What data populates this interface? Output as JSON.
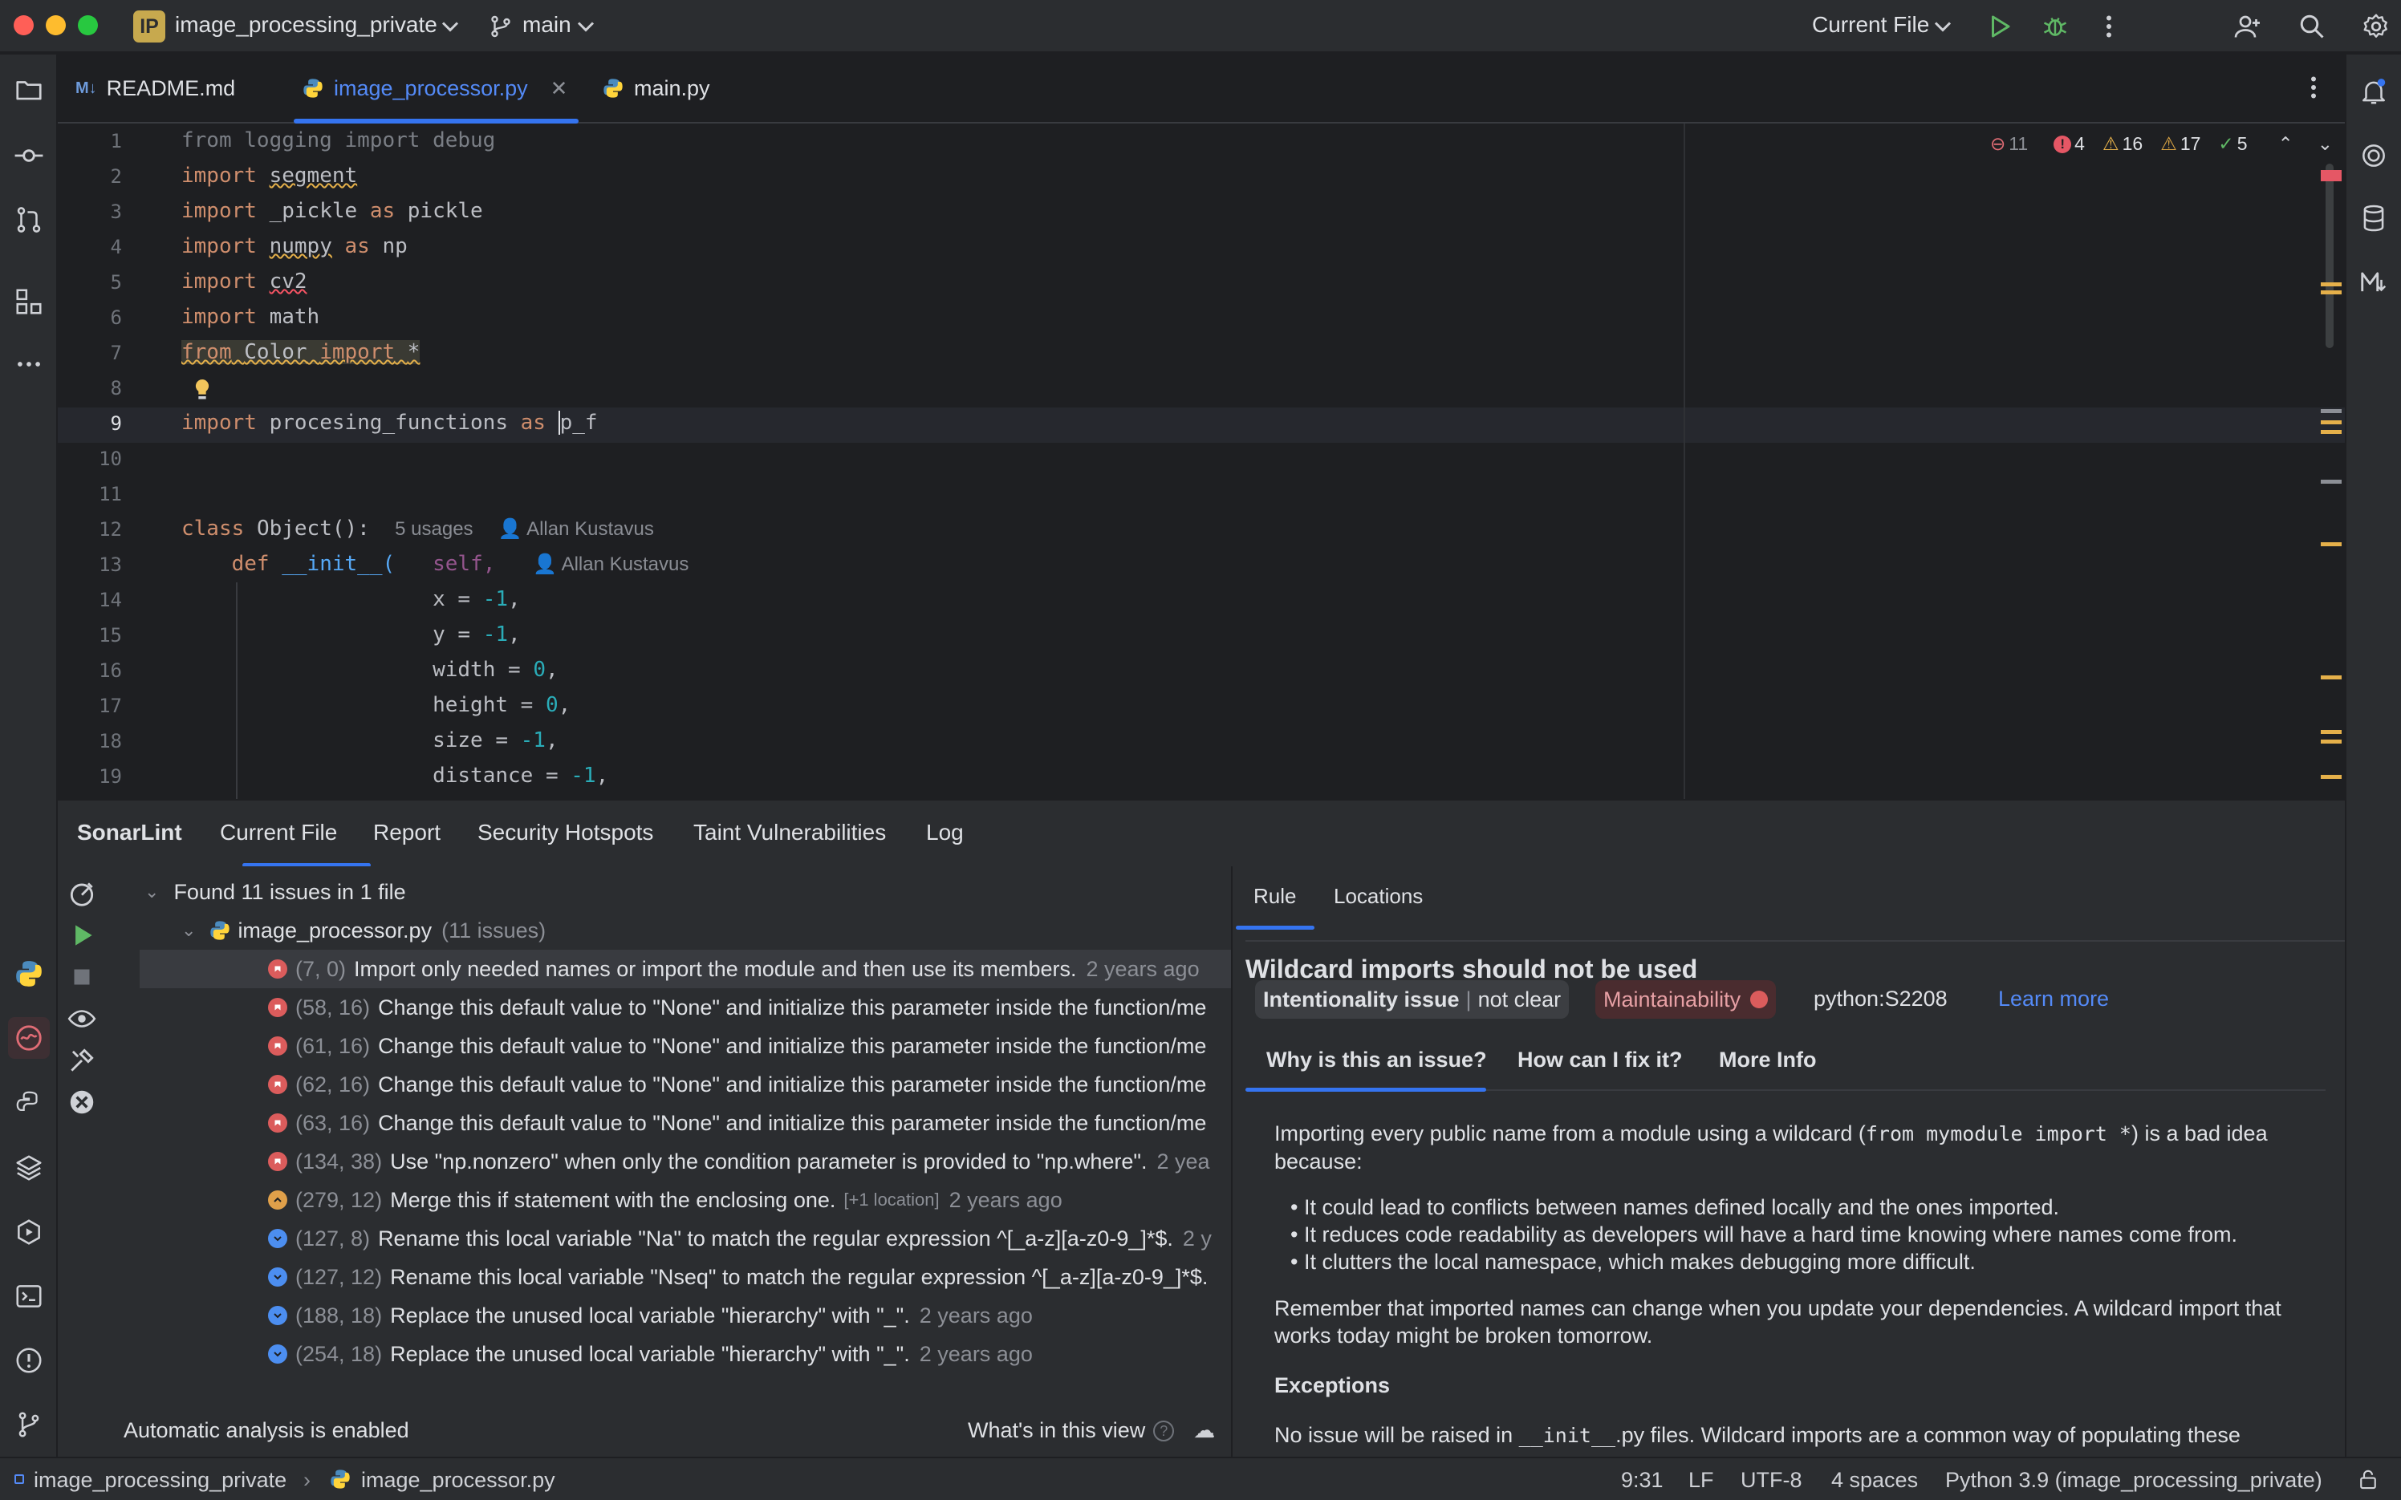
{
  "titlebar": {
    "project_badge": "IP",
    "project_name": "image_processing_private",
    "branch": "main",
    "run_config": "Current File",
    "colors": {
      "close": "#ff5f57",
      "minimize": "#febc2e",
      "maximize": "#28c840"
    }
  },
  "tabs": [
    {
      "label": "README.md",
      "icon": "markdown-icon"
    },
    {
      "label": "image_processor.py",
      "icon": "python-file-icon",
      "active": true
    },
    {
      "label": "main.py",
      "icon": "python-file-icon"
    }
  ],
  "tab_badges": {
    "markdown": "M↓"
  },
  "editor": {
    "inspection": {
      "sonar_errors": "11",
      "errors": "4",
      "warnings": "16",
      "weak_warnings": "17",
      "ok": "5"
    },
    "line_numbers": [
      "1",
      "2",
      "3",
      "4",
      "5",
      "6",
      "7",
      "8",
      "9",
      "10",
      "11",
      "12",
      "13",
      "14",
      "15",
      "16",
      "17",
      "18",
      "19"
    ],
    "code": {
      "l1": "from logging import debug",
      "l2_kw": "import",
      "l2_mod": "segment",
      "l3_kw": "import",
      "l3_mod": "_pickle",
      "l3_as": "as",
      "l3_alias": "pickle",
      "l4_kw": "import",
      "l4_mod": "numpy",
      "l4_as": "as",
      "l4_alias": "np",
      "l5_kw": "import",
      "l5_mod": "cv2",
      "l6_kw": "import",
      "l6_mod": "math",
      "l7_from": "from",
      "l7_mod": "Color",
      "l7_kw": "import",
      "l7_star": "*",
      "l9_kw": "import",
      "l9_mod": "procesing_functions",
      "l9_as": "as",
      "l9_alias": "p_f",
      "l12_kw": "class",
      "l12_name": "Object():",
      "l12_usages": "5 usages",
      "l12_author": "Allan Kustavus",
      "l13_kw": "def",
      "l13_fn": "__init__(",
      "l13_self": "self,",
      "l13_author": "Allan Kustavus",
      "l14_name": "x = ",
      "l14_val": "-1",
      "l14_end": ",",
      "l15_name": "y = ",
      "l15_val": "-1",
      "l15_end": ",",
      "l16_name": "width = ",
      "l16_val": "0",
      "l16_end": ",",
      "l17_name": "height = ",
      "l17_val": "0",
      "l17_end": ",",
      "l18_name": "size = ",
      "l18_val": "-1",
      "l18_end": ",",
      "l19_name": "distance = ",
      "l19_val": "-1",
      "l19_end": ","
    }
  },
  "sonarlint": {
    "title": "SonarLint",
    "tabs": [
      "Current File",
      "Report",
      "Security Hotspots",
      "Taint Vulnerabilities",
      "Log"
    ],
    "summary": "Found 11 issues in 1 file",
    "file": {
      "name": "image_processor.py",
      "count": "(11 issues)"
    },
    "issues": [
      {
        "loc": "(7, 0)",
        "msg": "Import only needed names or import the module and then use its members.",
        "ago": "2 years ago",
        "severity": "blocker"
      },
      {
        "loc": "(58, 16)",
        "msg": "Change this default value to \"None\" and initialize this parameter inside the function/me",
        "ago": "",
        "severity": "blocker"
      },
      {
        "loc": "(61, 16)",
        "msg": "Change this default value to \"None\" and initialize this parameter inside the function/me",
        "ago": "",
        "severity": "blocker"
      },
      {
        "loc": "(62, 16)",
        "msg": "Change this default value to \"None\" and initialize this parameter inside the function/me",
        "ago": "",
        "severity": "blocker"
      },
      {
        "loc": "(63, 16)",
        "msg": "Change this default value to \"None\" and initialize this parameter inside the function/me",
        "ago": "",
        "severity": "blocker"
      },
      {
        "loc": "(134, 38)",
        "msg": "Use \"np.nonzero\" when only the condition parameter is provided to \"np.where\".",
        "ago": "2 yea",
        "severity": "blocker"
      },
      {
        "loc": "(279, 12)",
        "msg": "Merge this if statement with the enclosing one.",
        "extra": "[+1 location]",
        "ago": "2 years ago",
        "severity": "major"
      },
      {
        "loc": "(127, 8)",
        "msg": "Rename this local variable \"Na\" to match the regular expression ^[_a-z][a-z0-9_]*$.",
        "ago": "2 y",
        "severity": "minor"
      },
      {
        "loc": "(127, 12)",
        "msg": "Rename this local variable \"Nseq\" to match the regular expression ^[_a-z][a-z0-9_]*$.",
        "ago": "",
        "severity": "minor"
      },
      {
        "loc": "(188, 18)",
        "msg": "Replace the unused local variable \"hierarchy\" with \"_\".",
        "ago": "2 years ago",
        "severity": "minor"
      },
      {
        "loc": "(254, 18)",
        "msg": "Replace the unused local variable \"hierarchy\" with \"_\".",
        "ago": "2 years ago",
        "severity": "minor"
      }
    ],
    "footer_status": "Automatic analysis is enabled",
    "footer_help": "What's in this view",
    "severity_colors": {
      "blocker": "#db5c5c",
      "major": "#e0a04a",
      "minor": "#4c8ef0"
    }
  },
  "rule": {
    "tabs": [
      "Rule",
      "Locations"
    ],
    "title": "Wildcard imports should not be used",
    "badge_type": "Intentionality issue",
    "badge_sub": "not clear",
    "badge_quality": "Maintainability",
    "rule_key": "python:S2208",
    "learn_more": "Learn more",
    "subtabs": [
      "Why is this an issue?",
      "How can I fix it?",
      "More Info"
    ],
    "intro_pre": "Importing every public name from a module using a wildcard (",
    "intro_code": "from mymodule import *",
    "intro_post": ") is a bad idea because:",
    "bullets": [
      "It could lead to conflicts between names defined locally and the ones imported.",
      "It reduces code readability as developers will have a hard time knowing where names come from.",
      "It clutters the local namespace, which makes debugging more difficult."
    ],
    "remember": "Remember that imported names can change when you update your dependencies. A wildcard import that works today might be broken tomorrow.",
    "exceptions_title": "Exceptions",
    "exceptions_text_pre": "No issue will be raised in ",
    "exceptions_code": "__init__",
    "exceptions_text_post": ".py files. Wildcard imports are a common way of populating these"
  },
  "statusbar": {
    "project": "image_processing_private",
    "file": "image_processor.py",
    "caret": "9:31",
    "line_sep": "LF",
    "encoding": "UTF-8",
    "indent": "4 spaces",
    "interpreter": "Python 3.9 (image_processing_private)"
  }
}
